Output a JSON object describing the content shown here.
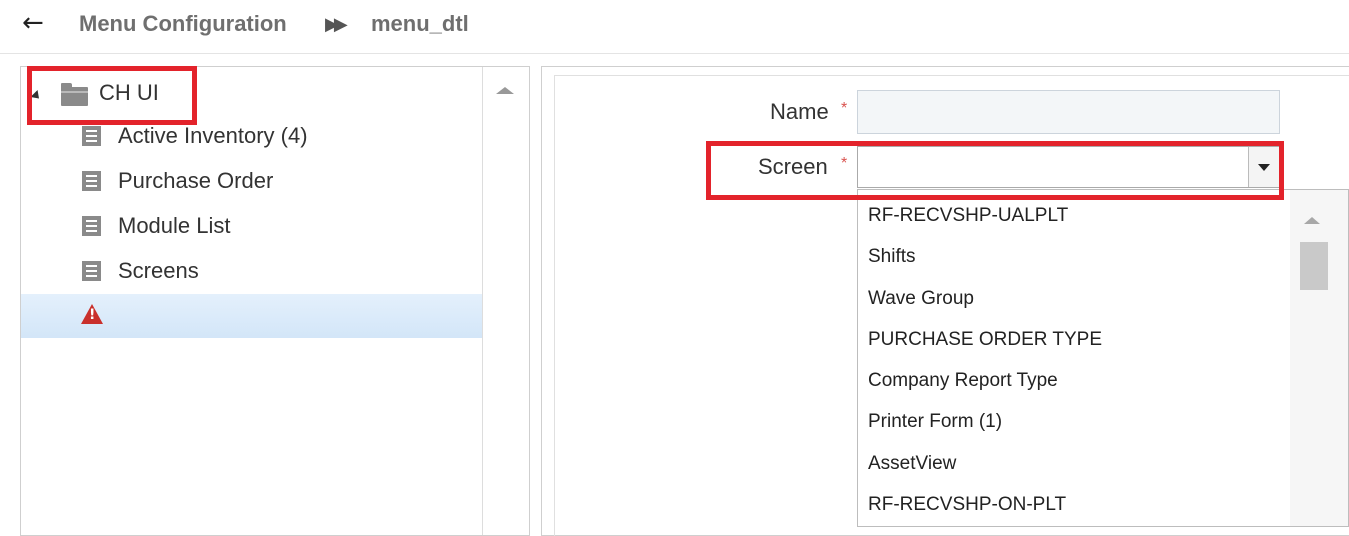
{
  "breadcrumb": {
    "back_icon": "arrow-left-icon",
    "items": [
      "Menu Configuration",
      "menu_dtl"
    ],
    "separator_icon": "double-chevron-right-icon"
  },
  "tree": {
    "root": {
      "label": "CH UI",
      "icon": "folder-icon",
      "expanded": true
    },
    "children": [
      {
        "label": "Active Inventory (4)",
        "icon": "document-icon"
      },
      {
        "label": "Purchase Order",
        "icon": "document-icon"
      },
      {
        "label": "Module List",
        "icon": "document-icon"
      },
      {
        "label": "Screens",
        "icon": "document-icon"
      },
      {
        "label": "",
        "icon": "warning-icon",
        "selected": true
      }
    ]
  },
  "form": {
    "name_label": "Name",
    "name_value": "",
    "screen_label": "Screen",
    "screen_value": "",
    "required_marker": "*"
  },
  "screen_options": [
    "RF-RECVSHP-UALPLT",
    "Shifts",
    "Wave Group",
    "PURCHASE ORDER TYPE",
    "Company Report Type",
    "Printer Form (1)",
    "AssetView",
    "RF-RECVSHP-ON-PLT"
  ],
  "colors": {
    "highlight": "#e3232b",
    "required": "#d9534f",
    "selected_row": "#d3e6f8"
  }
}
